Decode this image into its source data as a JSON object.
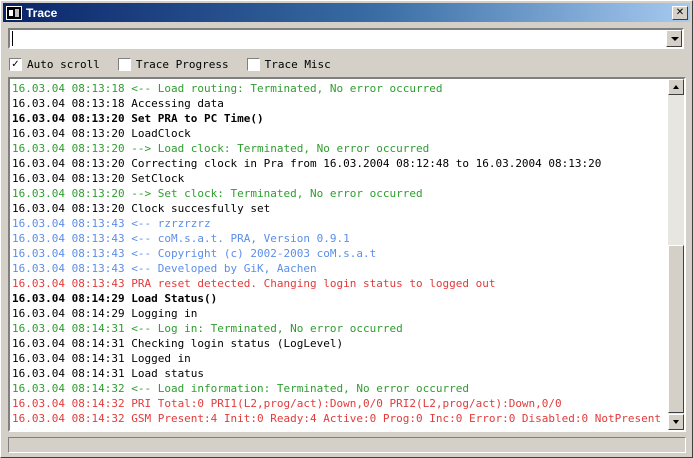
{
  "window": {
    "title": "Trace",
    "close_glyph": "✕"
  },
  "command": {
    "value": "",
    "placeholder": ""
  },
  "options": [
    {
      "label": "Auto scroll",
      "checked": true
    },
    {
      "label": "Trace Progress",
      "checked": false
    },
    {
      "label": "Trace Misc",
      "checked": false
    }
  ],
  "colors": {
    "green": "#2e9e2e",
    "black": "#000000",
    "blue": "#5c8ee8",
    "red": "#e23b3b",
    "titlebar": "#0a246a"
  },
  "log": [
    {
      "text": "16.03.04 08:13:18 <-- Load routing: Terminated, No error occurred",
      "color": "green",
      "bold": false
    },
    {
      "text": "16.03.04 08:13:18 Accessing data",
      "color": "black",
      "bold": false
    },
    {
      "text": "16.03.04 08:13:20 Set PRA to PC Time()",
      "color": "black",
      "bold": true
    },
    {
      "text": "16.03.04 08:13:20 LoadClock",
      "color": "black",
      "bold": false
    },
    {
      "text": "16.03.04 08:13:20 --> Load clock: Terminated, No error occurred",
      "color": "green",
      "bold": false
    },
    {
      "text": "16.03.04 08:13:20 Correcting clock in Pra from 16.03.2004 08:12:48 to 16.03.2004 08:13:20",
      "color": "black",
      "bold": false
    },
    {
      "text": "16.03.04 08:13:20 SetClock",
      "color": "black",
      "bold": false
    },
    {
      "text": "16.03.04 08:13:20 --> Set clock: Terminated, No error occurred",
      "color": "green",
      "bold": false
    },
    {
      "text": "16.03.04 08:13:20 Clock succesfully set",
      "color": "black",
      "bold": false
    },
    {
      "text": "16.03.04 08:13:43 <-- rzrzrzrz",
      "color": "blue",
      "bold": false
    },
    {
      "text": "16.03.04 08:13:43 <-- coM.s.a.t. PRA, Version 0.9.1",
      "color": "blue",
      "bold": false
    },
    {
      "text": "16.03.04 08:13:43 <-- Copyright (c) 2002-2003 coM.s.a.t",
      "color": "blue",
      "bold": false
    },
    {
      "text": "16.03.04 08:13:43 <-- Developed by GiK, Aachen",
      "color": "blue",
      "bold": false
    },
    {
      "text": "16.03.04 08:13:43 PRA reset detected. Changing login status to logged out",
      "color": "red",
      "bold": false
    },
    {
      "text": "16.03.04 08:14:29 Load Status()",
      "color": "black",
      "bold": true
    },
    {
      "text": "16.03.04 08:14:29 Logging in",
      "color": "black",
      "bold": false
    },
    {
      "text": "16.03.04 08:14:31 <-- Log in: Terminated, No error occurred",
      "color": "green",
      "bold": false
    },
    {
      "text": "16.03.04 08:14:31 Checking login status (LogLevel)",
      "color": "black",
      "bold": false
    },
    {
      "text": "16.03.04 08:14:31 Logged in",
      "color": "black",
      "bold": false
    },
    {
      "text": "16.03.04 08:14:31 Load status",
      "color": "black",
      "bold": false
    },
    {
      "text": "16.03.04 08:14:32 <-- Load information: Terminated, No error occurred",
      "color": "green",
      "bold": false
    },
    {
      "text": "16.03.04 08:14:32 PRI Total:0 PRI1(L2,prog/act):Down,0/0 PRI2(L2,prog/act):Down,0/0",
      "color": "red",
      "bold": false
    },
    {
      "text": "16.03.04 08:14:32 GSM Present:4 Init:0 Ready:4 Active:0 Prog:0 Inc:0 Error:0 Disabled:0 NotPresent",
      "color": "red",
      "bold": false
    }
  ]
}
